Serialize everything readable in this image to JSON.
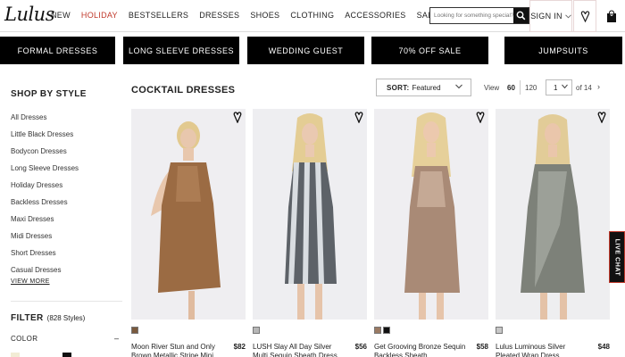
{
  "brand": {
    "logo": "Lulus"
  },
  "nav": {
    "items": [
      {
        "label": "NEW",
        "highlight": false
      },
      {
        "label": "HOLIDAY",
        "highlight": true
      },
      {
        "label": "BESTSELLERS",
        "highlight": false
      },
      {
        "label": "DRESSES",
        "highlight": false
      },
      {
        "label": "SHOES",
        "highlight": false
      },
      {
        "label": "CLOTHING",
        "highlight": false
      },
      {
        "label": "ACCESSORIES",
        "highlight": false
      },
      {
        "label": "SALE",
        "highlight": false
      }
    ],
    "search_placeholder": "Looking for something special?",
    "sign_in": "SIGN IN",
    "bag_count": "0"
  },
  "categories": [
    "FORMAL DRESSES",
    "LONG SLEEVE DRESSES",
    "WEDDING GUEST",
    "70% OFF SALE",
    "JUMPSUITS"
  ],
  "sidebar": {
    "heading": "SHOP BY STYLE",
    "items": [
      "All Dresses",
      "Little Black Dresses",
      "Bodycon Dresses",
      "Long Sleeve Dresses",
      "Holiday Dresses",
      "Backless Dresses",
      "Maxi Dresses",
      "Midi Dresses",
      "Short Dresses",
      "Casual Dresses"
    ],
    "view_more": "VIEW MORE",
    "filter": "FILTER",
    "filter_count": "(828 Styles)",
    "color": "COLOR",
    "color_toggle": "–"
  },
  "main": {
    "title": "COCKTAIL DRESSES",
    "sort_label": "SORT:",
    "sort_value": "Featured",
    "view_label": "View",
    "view_60": "60",
    "view_120": "120",
    "page": "1",
    "page_of": "of 14",
    "next": "›"
  },
  "products": [
    {
      "name": "Moon River Stun and Only Brown Metallic Stripe Mini",
      "price": "$82",
      "swatches": [
        "#7a5a3e"
      ],
      "dress": "#9b6b43",
      "dress2": "#b3835a"
    },
    {
      "name": "LUSH Slay All Day Silver Multi Sequin Sheath Dress",
      "price": "$56",
      "swatches": [
        "#b7b7b7"
      ],
      "dress": "#9ea3a8",
      "dress2": "#5d6268"
    },
    {
      "name": "Get Grooving Bronze Sequin Backless Sheath",
      "price": "$58",
      "swatches": [
        "#9a7a63",
        "#111111"
      ],
      "dress": "#a98a76",
      "dress2": "#d2b7a3"
    },
    {
      "name": "Lulus Luminous Silver Pleated Wrap Dress",
      "price": "$48",
      "swatches": [
        "#c7c7c7"
      ],
      "dress": "#7d8179",
      "dress2": "#a7aba3"
    }
  ],
  "live_chat": "LIVE CHAT",
  "colors": {
    "accent": "#c0392b",
    "black": "#000000"
  }
}
